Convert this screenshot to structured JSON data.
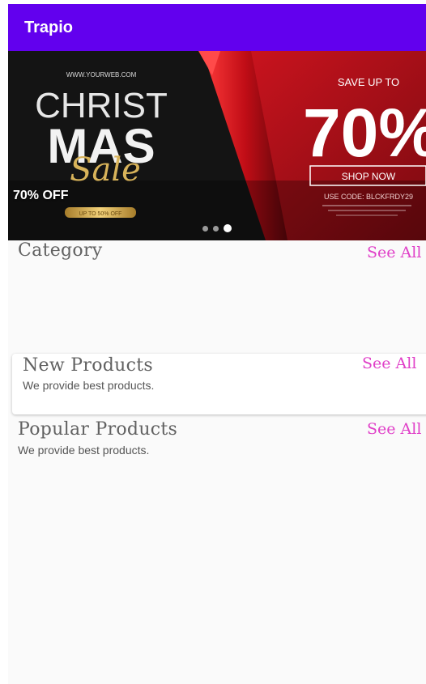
{
  "app_bar": {
    "title": "Trapio"
  },
  "banner": {
    "caption": "70% OFF",
    "slide_count": 3,
    "active_slide": 3,
    "artwork": {
      "website": "WWW.YOURWEB.COM",
      "headline_1": "CHRIST",
      "headline_2": "MAS",
      "script": "Sale",
      "ribbon_text": "UP TO 50% OFF",
      "save_text": "SAVE UP TO",
      "percent": "70%",
      "shop_now": "SHOP NOW",
      "code": "USE CODE: BLCKFRDY29"
    }
  },
  "category": {
    "title": "Category",
    "see_all": "See All"
  },
  "new_products": {
    "title": "New Products",
    "subtitle": "We provide best products.",
    "see_all": "See All"
  },
  "popular_products": {
    "title": "Popular Products",
    "subtitle": "We provide best products.",
    "see_all": "See All"
  },
  "colors": {
    "primary": "#6200ee",
    "accent": "#e040c8",
    "banner_red": "#b3121b"
  }
}
